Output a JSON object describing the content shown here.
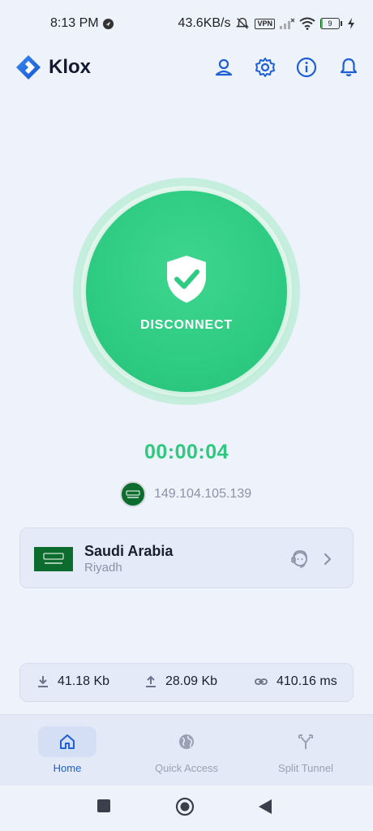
{
  "status_bar": {
    "time": "8:13 PM",
    "speed": "43.6KB/s",
    "vpn": "VPN",
    "battery_level": "9",
    "battery_fraction": 0.09
  },
  "header": {
    "app_name": "Klox",
    "icons": [
      "account-icon",
      "settings-icon",
      "info-icon",
      "notification-icon"
    ]
  },
  "connect": {
    "label": "DISCONNECT",
    "timer": "00:00:04",
    "ip": "149.104.105.139"
  },
  "server": {
    "country": "Saudi Arabia",
    "city": "Riyadh"
  },
  "stats": {
    "download": "41.18 Kb",
    "upload": "28.09 Kb",
    "ping": "410.16 ms"
  },
  "nav": {
    "home": "Home",
    "quick_access": "Quick Access",
    "split_tunnel": "Split Tunnel"
  },
  "colors": {
    "accent": "#1d5fd8",
    "connected_green": "#2ecb82",
    "background": "#eef2fb"
  }
}
